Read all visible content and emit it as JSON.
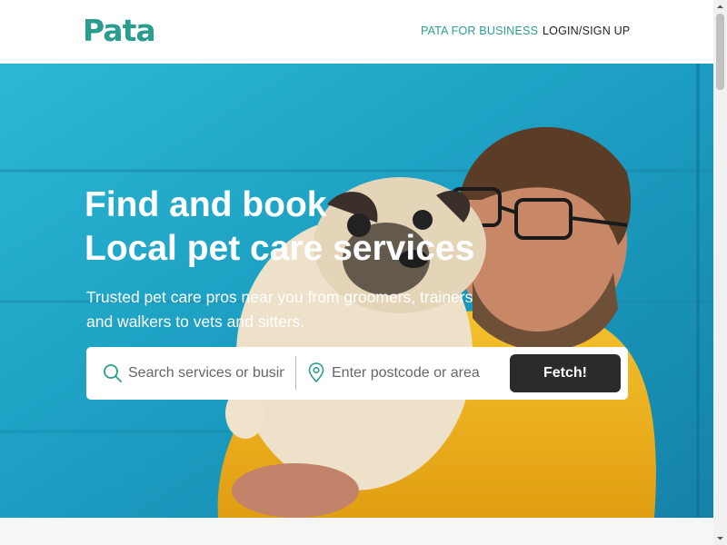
{
  "header": {
    "logo_text": "Pata",
    "nav": {
      "business_label": "PATA FOR BUSINESS",
      "login_label": "LOGIN/SIGN UP"
    }
  },
  "hero": {
    "title_line1": "Find and book",
    "title_line2": "Local pet care services",
    "subtitle_line1": "Trusted pet care pros near you from groomers, trainers",
    "subtitle_line2": "and walkers to vets and sitters.",
    "search": {
      "service_placeholder": "Search services or businesses",
      "location_placeholder": "Enter postcode or area",
      "submit_label": "Fetch!"
    }
  },
  "icons": {
    "search": "search-icon",
    "location": "map-pin-icon",
    "logo_mark": "paw-icon"
  },
  "colors": {
    "brand": "#2a9d8f",
    "button": "#2b2b2b",
    "hero_bg": "#1a9cc0",
    "hoodie": "#f0b521"
  }
}
